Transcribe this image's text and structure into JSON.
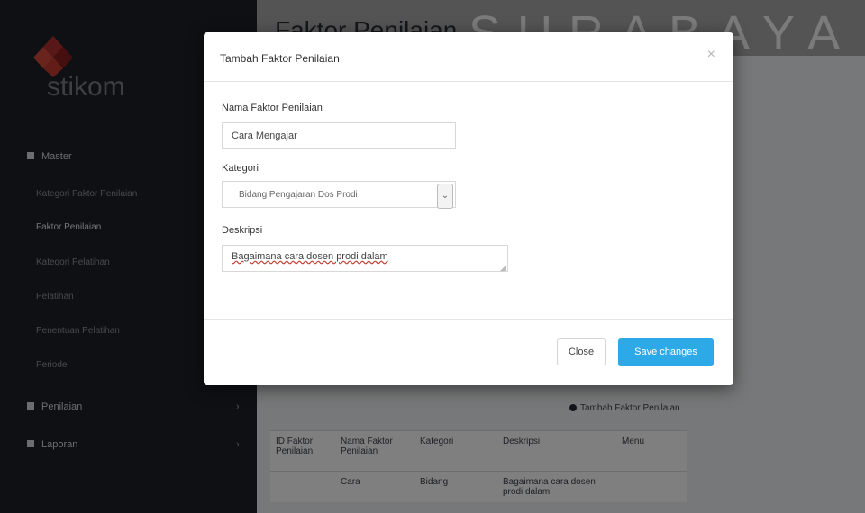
{
  "watermark": "SURABAYA",
  "logo": {
    "text": "stikom"
  },
  "page": {
    "title": "Faktor Penilaian"
  },
  "sidebar": {
    "sections": [
      {
        "label": "Master"
      },
      {
        "label": "Penilaian"
      },
      {
        "label": "Laporan"
      }
    ],
    "items": [
      {
        "label": "Kategori Faktor Penilaian"
      },
      {
        "label": "Faktor Penilaian"
      },
      {
        "label": "Kategori Pelatihan"
      },
      {
        "label": "Pelatihan"
      },
      {
        "label": "Penentuan Pelatihan"
      },
      {
        "label": "Periode"
      }
    ]
  },
  "main": {
    "add_link": "Tambah Faktor Penilaian",
    "table": {
      "headers": [
        "ID Faktor Penilaian",
        "Nama Faktor Penilaian",
        "Kategori",
        "Deskripsi",
        "Menu"
      ],
      "row": [
        "",
        "Cara",
        "Bidang",
        "Bagaimana cara dosen prodi dalam",
        ""
      ]
    }
  },
  "modal": {
    "title": "Tambah Faktor Penilaian",
    "close_icon": "×",
    "fields": {
      "nama": {
        "label": "Nama Faktor Penilaian",
        "value": "Cara Mengajar"
      },
      "kategori": {
        "label": "Kategori",
        "value": "Bidang Pengajaran Dos Prodi"
      },
      "deskripsi": {
        "label": "Deskripsi",
        "value": "Bagaimana cara dosen prodi dalam"
      }
    },
    "buttons": {
      "close": "Close",
      "save": "Save changes"
    }
  },
  "colors": {
    "primary": "#2ea9e8",
    "sidebar": "#1c2028",
    "overlay": "rgba(0,0,0,0.5)"
  }
}
